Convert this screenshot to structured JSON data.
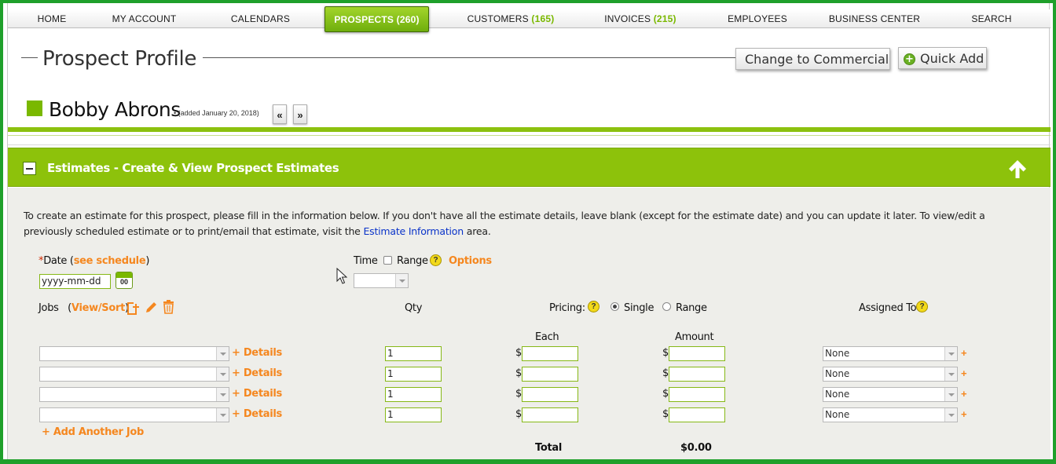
{
  "nav": {
    "tabs": [
      {
        "label": "HOME",
        "count": ""
      },
      {
        "label": "MY ACCOUNT",
        "count": ""
      },
      {
        "label": "CALENDARS",
        "count": ""
      },
      {
        "label": "PROSPECTS (260)",
        "count": ""
      },
      {
        "label": "CUSTOMERS",
        "count": "(165)"
      },
      {
        "label": "INVOICES",
        "count": "(215)"
      },
      {
        "label": "EMPLOYEES",
        "count": ""
      },
      {
        "label": "BUSINESS CENTER",
        "count": ""
      },
      {
        "label": "SEARCH",
        "count": ""
      }
    ],
    "active_tab": "PROSPECTS (260)"
  },
  "header": {
    "title": "Prospect Profile",
    "change_button": "Change to Commercial",
    "quick_add_button": "Quick Add",
    "quick_add_icon": "+"
  },
  "prospect": {
    "name": "Bobby Abrons",
    "added": "• (added January 20, 2018)",
    "prev_label": "«",
    "next_label": "»"
  },
  "section": {
    "title": "Estimates - Create & View Prospect Estimates",
    "intro_text": "To create an estimate for this prospect, please fill in the information below. If you don't have all the estimate details, leave blank (except for the estimate date) and you can update it later. To view/edit a previously scheduled estimate or to print/email that estimate, visit the ",
    "intro_link": "Estimate Information",
    "intro_tail": " area."
  },
  "form": {
    "date_required_mark": "*",
    "date_label": "Date",
    "see_schedule_open": " (",
    "see_schedule": "see schedule",
    "see_schedule_close": ")",
    "date_placeholder": "yyyy-mm-dd",
    "calendar_num": "00",
    "time_label": "Time",
    "range_label": "Range",
    "options_label": "Options",
    "help_glyph": "?",
    "jobs_label": "Jobs",
    "view_sort_open": "(",
    "view_sort": "View/Sort",
    "view_sort_close": ")",
    "qty_label": "Qty",
    "pricing_label": "Pricing:",
    "single_label": "Single",
    "range_pricing_label": "Range",
    "pricing_selected": "Single",
    "assigned_label": "Assigned To",
    "each_label": "Each",
    "amount_label": "Amount",
    "details_label": "+ Details",
    "currency": "$",
    "add_job": "+ Add Another Job",
    "total_label": "Total",
    "total_value": "$0.00",
    "rows": [
      {
        "qty": "1",
        "assigned": "None",
        "plus": "+"
      },
      {
        "qty": "1",
        "assigned": "None",
        "plus": "+"
      },
      {
        "qty": "1",
        "assigned": "None",
        "plus": "+"
      },
      {
        "qty": "1",
        "assigned": "None",
        "plus": "+"
      }
    ]
  },
  "colors": {
    "brand_green": "#8dc20b",
    "accent_orange": "#f5871f",
    "link_blue": "#0a33c9"
  }
}
